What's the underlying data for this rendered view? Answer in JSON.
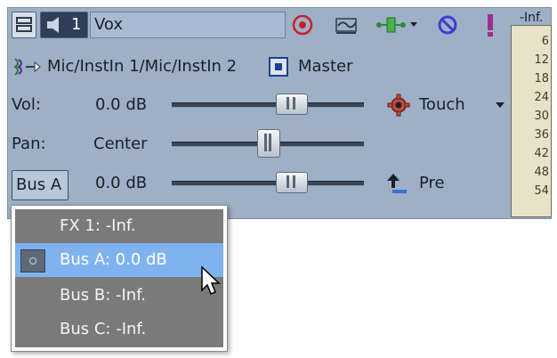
{
  "track": {
    "number": "1",
    "name": "Vox",
    "input_route": "Mic/InstIn 1/Mic/InstIn 2",
    "output": "Master",
    "vol_label": "Vol:",
    "vol_value": "0.0 dB",
    "vol_level": 0.62,
    "automation_mode": "Touch",
    "pan_label": "Pan:",
    "pan_value": "Center",
    "pan_level": 0.5,
    "bus_button": "Bus A",
    "bus_value": "0.0 dB",
    "bus_level": 0.62,
    "send_mode": "Pre"
  },
  "meter": {
    "header": "-Inf.",
    "ticks": [
      "6",
      "12",
      "18",
      "24",
      "30",
      "36",
      "42",
      "48",
      "54"
    ]
  },
  "dropdown": {
    "items": [
      {
        "label": "FX 1: -Inf.",
        "selected": false
      },
      {
        "label": "Bus A: 0.0 dB",
        "selected": true
      },
      {
        "label": "Bus B: -Inf.",
        "selected": false
      },
      {
        "label": "Bus C: -Inf.",
        "selected": false
      }
    ]
  },
  "icons": [
    "track-menu-icon",
    "mute-icon",
    "record-arm-icon",
    "automation-icon",
    "fx-icon",
    "solo-icon",
    "exclamation-icon",
    "input-route-icon",
    "output-icon",
    "gear-icon",
    "arrow-icon",
    "pointer-cursor-icon"
  ]
}
